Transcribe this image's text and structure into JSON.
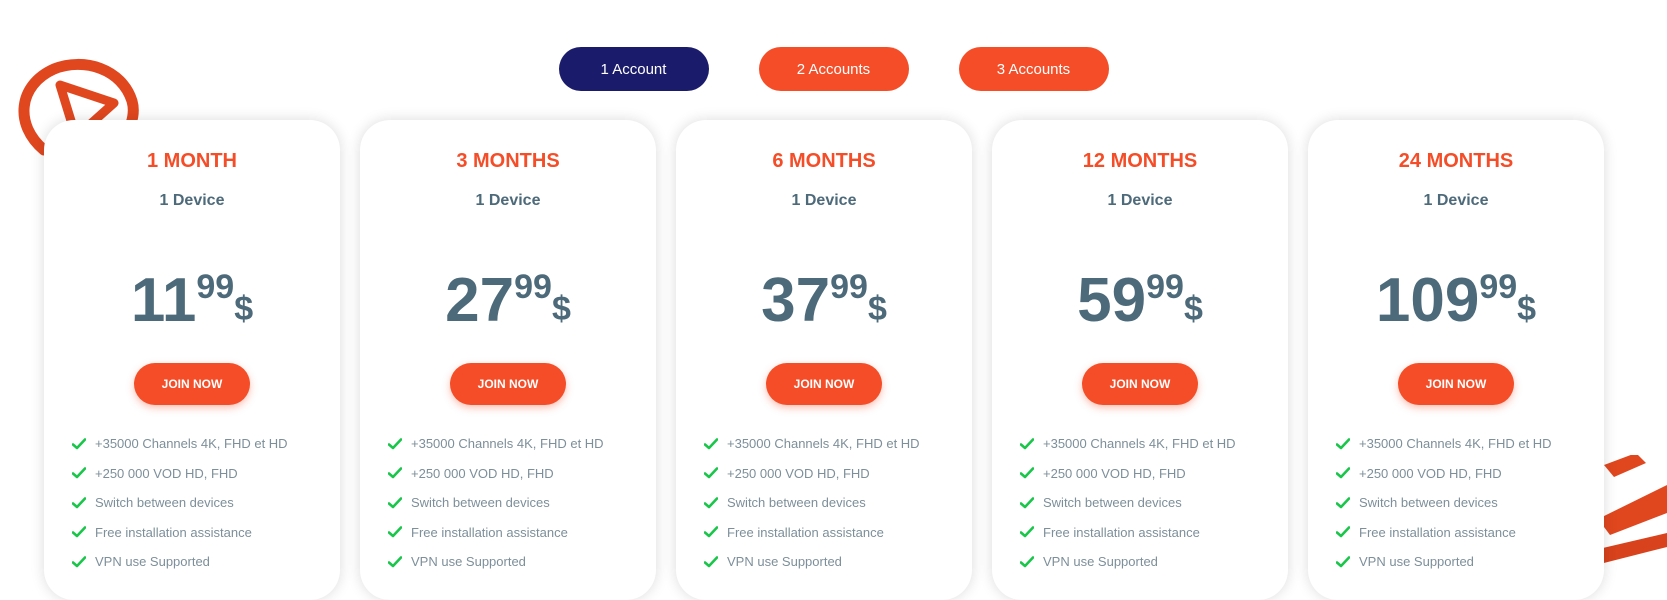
{
  "tabs": [
    {
      "label": "1 Account",
      "active": true
    },
    {
      "label": "2 Accounts",
      "active": false
    },
    {
      "label": "3 Accounts",
      "active": false
    }
  ],
  "plans": [
    {
      "title": "1 MONTH",
      "device": "1 Device",
      "price_main": "11",
      "price_cents": "99",
      "currency": "$",
      "cta": "JOIN NOW"
    },
    {
      "title": "3 MONTHS",
      "device": "1 Device",
      "price_main": "27",
      "price_cents": "99",
      "currency": "$",
      "cta": "JOIN NOW"
    },
    {
      "title": "6 MONTHS",
      "device": "1 Device",
      "price_main": "37",
      "price_cents": "99",
      "currency": "$",
      "cta": "JOIN NOW"
    },
    {
      "title": "12 MONTHS",
      "device": "1 Device",
      "price_main": "59",
      "price_cents": "99",
      "currency": "$",
      "cta": "JOIN NOW"
    },
    {
      "title": "24 MONTHS",
      "device": "1 Device",
      "price_main": "109",
      "price_cents": "99",
      "currency": "$",
      "cta": "JOIN NOW"
    }
  ],
  "features": [
    "+35000 Channels 4K, FHD et HD",
    "+250 000 VOD HD, FHD",
    "Switch between devices",
    "Free installation assistance",
    "VPN use Supported"
  ],
  "icons": {
    "feature": "check-icon",
    "deco_left": "orange-play-logo-fragment",
    "deco_right": "orange-brush-stroke"
  },
  "colors": {
    "accent": "#f44d27",
    "tab_active": "#1a1c6b",
    "price_text": "#4d6a7a",
    "feature_text": "#7d8f9a",
    "check": "#18c64a"
  }
}
